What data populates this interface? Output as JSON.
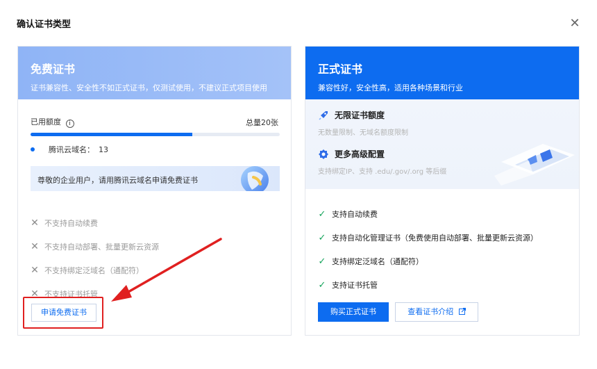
{
  "dialog": {
    "title": "确认证书类型",
    "close_glyph": "✕"
  },
  "free_card": {
    "title": "免费证书",
    "subtitle": "证书兼容性、安全性不如正式证书，仅测试使用，不建议正式项目使用",
    "quota_label": "已用额度",
    "quota_total": "总量20张",
    "quota_used_fraction": 0.65,
    "domain_label": "腾讯云域名：",
    "domain_count": "13",
    "banner_text": "尊敬的企业用户，请用腾讯云域名申请免费证书",
    "features": [
      "不支持自动续费",
      "不支持自动部署、批量更新云资源",
      "不支持绑定泛域名（通配符）",
      "不支持证书托管"
    ],
    "apply_button": "申请免费证书"
  },
  "paid_card": {
    "title": "正式证书",
    "subtitle": "兼容性好，安全性高，适用各种场景和行业",
    "perks": [
      {
        "title": "无限证书额度",
        "sub": "无数量限制、无域名额度限制",
        "icon": "rocket-icon"
      },
      {
        "title": "更多高级配置",
        "sub": "支持绑定IP、支持 .edu/.gov/.org 等后缀",
        "icon": "gear-badge-icon"
      }
    ],
    "features": [
      "支持自动续费",
      "支持自动化管理证书（免费使用自动部署、批量更新云资源）",
      "支持绑定泛域名（通配符）",
      "支持证书托管"
    ],
    "buy_button": "购买正式证书",
    "intro_button": "查看证书介绍"
  },
  "colors": {
    "brand": "#0d6cf0",
    "success": "#13a35a",
    "highlight": "#e02020"
  }
}
